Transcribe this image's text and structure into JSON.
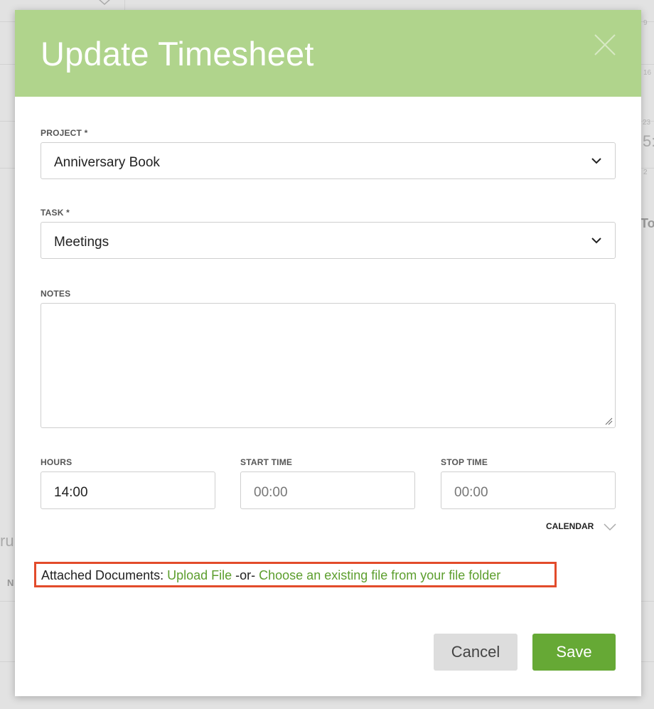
{
  "dialog": {
    "title": "Update Timesheet"
  },
  "form": {
    "project": {
      "label": "PROJECT *",
      "value": "Anniversary Book"
    },
    "task": {
      "label": "TASK *",
      "value": "Meetings"
    },
    "notes": {
      "label": "NOTES",
      "value": ""
    },
    "hours": {
      "label": "HOURS",
      "value": "14:00"
    },
    "start_time": {
      "label": "START TIME",
      "value": "00:00"
    },
    "stop_time": {
      "label": "STOP TIME",
      "value": "00:00"
    },
    "calendar_toggle": "CALENDAR"
  },
  "attachments": {
    "label": "Attached Documents: ",
    "upload_link": "Upload File",
    "separator": " -or- ",
    "choose_link": "Choose an existing file from your file folder"
  },
  "buttons": {
    "cancel": "Cancel",
    "save": "Save"
  },
  "background": {
    "date_9": "9",
    "date_16": "16",
    "date_23": "23",
    "partial_5": "5:",
    "date_2": "2",
    "partial_to": "To",
    "partial_ru": "ru",
    "partial_n": "N"
  },
  "colors": {
    "header": "#b0d48c",
    "accent_green": "#66a935",
    "link_green": "#5c9e2d",
    "highlight_red": "#e24b2b"
  }
}
